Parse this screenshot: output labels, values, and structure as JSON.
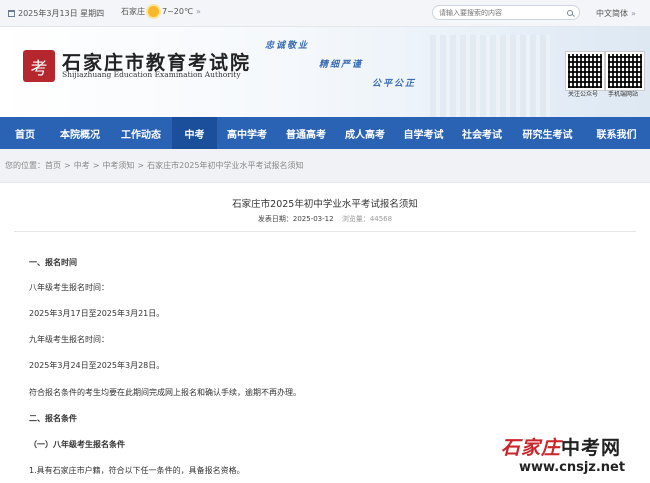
{
  "topbar": {
    "date": "2025年3月13日 星期四",
    "city": "石家庄",
    "temperature": "7~20℃",
    "search_placeholder": "请输入要搜索的内容",
    "language": "中文简体"
  },
  "header": {
    "seal_glyph": "考",
    "org_name_cn": "石家庄市教育考试院",
    "org_name_en": "Shijiazhuang Education Examination Authority",
    "slogans": [
      "忠诚敬业",
      "精细严谨",
      "公平公正"
    ],
    "qr_labels": [
      "关注公众号",
      "手机端网站"
    ]
  },
  "nav": {
    "items": [
      "首页",
      "本院概况",
      "工作动态",
      "中考",
      "高中学考",
      "普通高考",
      "成人高考",
      "自学考试",
      "社会考试",
      "研究生考试",
      "联系我们"
    ],
    "active_index": 3
  },
  "breadcrumb": {
    "prefix": "您的位置：",
    "items": [
      "首页",
      "中考",
      "中考须知",
      "石家庄市2025年初中学业水平考试报名须知"
    ],
    "separator": ">"
  },
  "article": {
    "title": "石家庄市2025年初中学业水平考试报名须知",
    "publish_label": "发表日期：",
    "publish_date": "2025-03-12",
    "views_label": "浏览量：",
    "views": "44568",
    "lines": [
      "一、报名时间",
      "八年级考生报名时间：",
      "2025年3月17日至2025年3月21日。",
      "九年级考生报名时间：",
      "2025年3月24日至2025年3月28日。",
      "符合报名条件的考生均要在此期间完成网上报名和确认手续，逾期不再办理。",
      "二、报名条件",
      "（一）八年级考生报名条件",
      "1.具有石家庄市户籍，符合以下任一条件的，具备报名资格。"
    ]
  },
  "watermark": {
    "brand_red": "石家庄",
    "brand_black": "中考网",
    "url": "www.cnsjz.net"
  },
  "colors": {
    "nav_bg": "#2a63b4",
    "nav_active": "#1b4f9c",
    "seal": "#b5272d",
    "slogan": "#3a6db5"
  }
}
